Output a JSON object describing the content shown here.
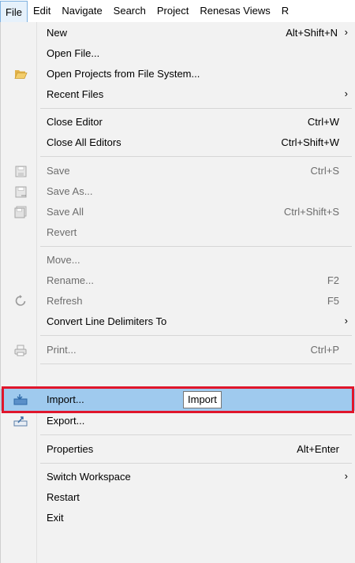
{
  "menubar": {
    "items": [
      "File",
      "Edit",
      "Navigate",
      "Search",
      "Project",
      "Renesas Views",
      "R"
    ]
  },
  "menu": {
    "items": [
      {
        "label": "New",
        "accel": "Alt+Shift+N",
        "arrow": "›"
      },
      {
        "label": "Open File..."
      },
      {
        "label": "Open Projects from File System...",
        "icon": "folder-open-icon"
      },
      {
        "label": "Recent Files",
        "arrow": "›"
      },
      {
        "label": "Close Editor",
        "accel": "Ctrl+W"
      },
      {
        "label": "Close All Editors",
        "accel": "Ctrl+Shift+W"
      },
      {
        "label": "Save",
        "accel": "Ctrl+S",
        "icon": "save-icon",
        "disabled": true
      },
      {
        "label": "Save As...",
        "icon": "save-as-icon",
        "disabled": true
      },
      {
        "label": "Save All",
        "accel": "Ctrl+Shift+S",
        "icon": "save-all-icon",
        "disabled": true
      },
      {
        "label": "Revert",
        "disabled": true
      },
      {
        "label": "Move...",
        "disabled": true
      },
      {
        "label": "Rename...",
        "accel": "F2",
        "disabled": true
      },
      {
        "label": "Refresh",
        "accel": "F5",
        "icon": "refresh-icon",
        "disabled": true
      },
      {
        "label": "Convert Line Delimiters To",
        "arrow": "›"
      },
      {
        "label": "Print...",
        "accel": "Ctrl+P",
        "icon": "print-icon",
        "disabled": true
      },
      {
        "label": "Import...",
        "icon": "import-icon",
        "highlighted": true
      },
      {
        "label": "Export...",
        "icon": "export-icon"
      },
      {
        "label": "Properties",
        "accel": "Alt+Enter"
      },
      {
        "label": "Switch Workspace",
        "arrow": "›"
      },
      {
        "label": "Restart"
      },
      {
        "label": "Exit"
      }
    ]
  },
  "tooltip": {
    "text": "Import"
  },
  "colors": {
    "highlight": "#9fcaee",
    "highlight_border": "#e0162b",
    "menu_background": "#f2f2f2"
  }
}
